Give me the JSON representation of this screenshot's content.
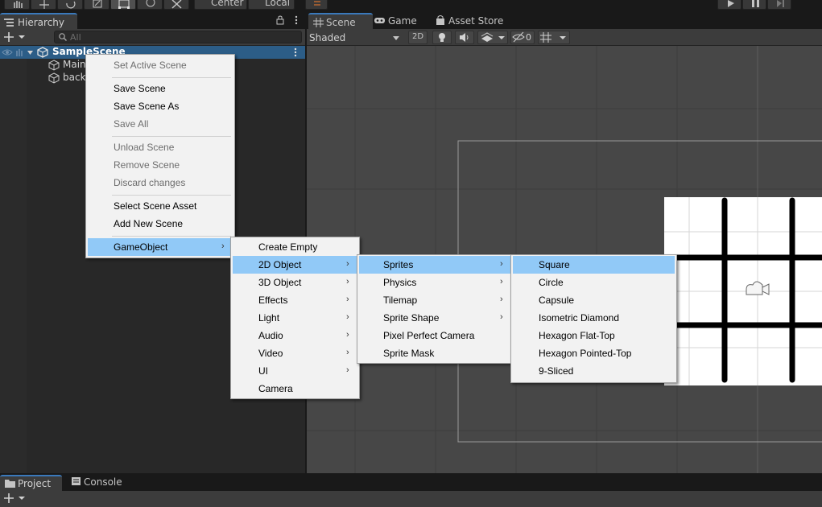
{
  "toolbar": {
    "pivot_label": "Center",
    "space_label": "Local",
    "tools": [
      "hand-tool",
      "move-tool",
      "rotate-tool",
      "scale-tool",
      "rect-tool",
      "transform-tool",
      "custom-tool"
    ],
    "play_controls": [
      "play",
      "pause",
      "step"
    ]
  },
  "hierarchy": {
    "tab_label": "Hierarchy",
    "search_placeholder": "All",
    "scene_name": "SampleScene",
    "items": [
      {
        "label": "Main",
        "icon": "gameobject-cube-icon"
      },
      {
        "label": "back",
        "icon": "gameobject-cube-icon"
      }
    ]
  },
  "scene_panel": {
    "tabs": [
      {
        "label": "Scene",
        "icon": "scene-grid-icon",
        "active": true
      },
      {
        "label": "Game",
        "icon": "gamepad-icon",
        "active": false
      },
      {
        "label": "Asset Store",
        "icon": "shopping-bag-icon",
        "active": false
      }
    ],
    "draw_mode": "Shaded",
    "mode_2d_label": "2D",
    "hidden_count": "0"
  },
  "context_menu": {
    "items": [
      {
        "label": "Set Active Scene",
        "disabled": true
      },
      {
        "label": "Save Scene",
        "disabled": false
      },
      {
        "label": "Save Scene As",
        "disabled": false
      },
      {
        "label": "Save All",
        "disabled": true
      },
      {
        "label": "Unload Scene",
        "disabled": true
      },
      {
        "label": "Remove Scene",
        "disabled": true
      },
      {
        "label": "Discard changes",
        "disabled": true
      },
      {
        "label": "Select Scene Asset",
        "disabled": false
      },
      {
        "label": "Add New Scene",
        "disabled": false
      },
      {
        "label": "GameObject",
        "disabled": false,
        "submenu": true,
        "highlighted": true
      }
    ]
  },
  "gameobject_menu": {
    "items": [
      {
        "label": "Create Empty",
        "submenu": false
      },
      {
        "label": "2D Object",
        "submenu": true,
        "highlighted": true
      },
      {
        "label": "3D Object",
        "submenu": true
      },
      {
        "label": "Effects",
        "submenu": true
      },
      {
        "label": "Light",
        "submenu": true
      },
      {
        "label": "Audio",
        "submenu": true
      },
      {
        "label": "Video",
        "submenu": true
      },
      {
        "label": "UI",
        "submenu": true
      },
      {
        "label": "Camera",
        "submenu": false
      }
    ]
  },
  "object2d_menu": {
    "items": [
      {
        "label": "Sprites",
        "submenu": true,
        "highlighted": true
      },
      {
        "label": "Physics",
        "submenu": true
      },
      {
        "label": "Tilemap",
        "submenu": true
      },
      {
        "label": "Sprite Shape",
        "submenu": true
      },
      {
        "label": "Pixel Perfect Camera",
        "submenu": false
      },
      {
        "label": "Sprite Mask",
        "submenu": false
      }
    ]
  },
  "sprites_menu": {
    "items": [
      {
        "label": "Square",
        "highlighted": true
      },
      {
        "label": "Circle"
      },
      {
        "label": "Capsule"
      },
      {
        "label": "Isometric Diamond"
      },
      {
        "label": "Hexagon Flat-Top"
      },
      {
        "label": "Hexagon Pointed-Top"
      },
      {
        "label": "9-Sliced"
      }
    ]
  },
  "bottom_panel": {
    "tabs": [
      {
        "label": "Project",
        "icon": "folder-icon",
        "active": true
      },
      {
        "label": "Console",
        "icon": "console-icon",
        "active": false
      }
    ]
  },
  "colors": {
    "menu_highlight": "#91c9f7",
    "selection_blue": "#2c5d87",
    "tab_accent": "#3a79bb"
  }
}
